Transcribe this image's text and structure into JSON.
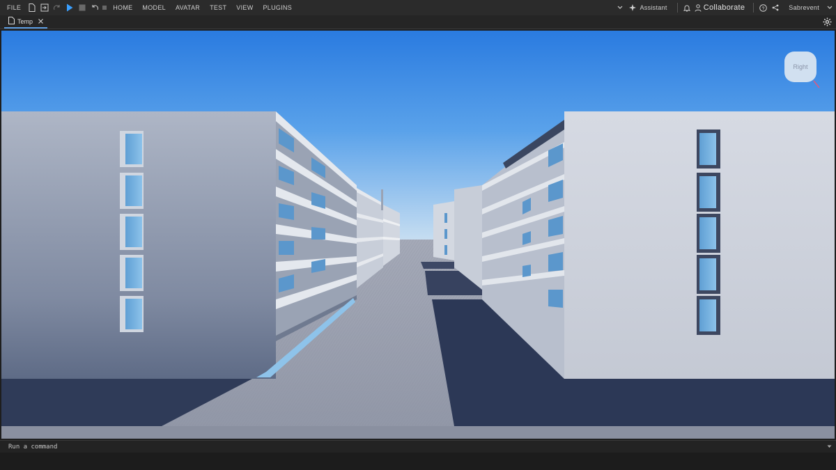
{
  "menu": {
    "file": "FILE",
    "home": "HOME",
    "model": "MODEL",
    "avatar": "AVATAR",
    "test": "TEST",
    "view": "VIEW",
    "plugins": "PLUGINS"
  },
  "toolbar_right": {
    "assistant": "Assistant",
    "collaborate": "Collaborate",
    "user": "Sabrevent"
  },
  "tab": {
    "label": "Temp"
  },
  "viewport": {
    "view_cube_label": "Right"
  },
  "command": {
    "placeholder": "Run a command"
  },
  "colors": {
    "accent": "#3aa0ff",
    "sky_top": "#2a7be0",
    "sky_bottom": "#c9dff2",
    "building": "#c5ccd8",
    "shadow": "#2f3d5c"
  }
}
